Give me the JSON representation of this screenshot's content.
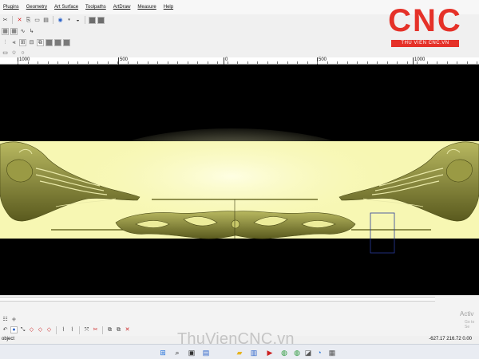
{
  "menu": [
    "Plugins",
    "Geometry",
    "Art Surface",
    "Toolpaths",
    "ArtDraw",
    "Measure",
    "Help"
  ],
  "logo": {
    "text": "CNC",
    "subtitle": "THU VIEN CNC.VN",
    "color": "#e53128"
  },
  "ruler": {
    "labels": [
      "1000",
      "500",
      "0",
      "500",
      "1000"
    ]
  },
  "canvas": {
    "background": "#000000",
    "relief_band_color": "#f7f7b3",
    "relief_color": "#8a8a3c"
  },
  "status": {
    "left_text": "object",
    "coordinates": "-627.17 216.72 0.00"
  },
  "activation": {
    "title": "Activ",
    "subtitle": "Go to Se"
  },
  "watermark": "ThuVienCNC.vn",
  "icons": {
    "toolbar1": [
      "cut-icon",
      "delete-icon",
      "copy-icon",
      "paste-icon",
      "print-icon",
      "globe-icon",
      "dropdown-icon",
      "preview-icon",
      "shield-icon",
      "shield-icon"
    ],
    "toolbar2": [
      "grid-icon",
      "grid-icon",
      "curve-icon",
      "arrow-icon"
    ],
    "toolbar3": [
      "align-icon",
      "distribute-icon",
      "grid-icon",
      "transform-icon",
      "copy-icon",
      "shield-icon",
      "shield-icon",
      "shield-icon"
    ],
    "toolbar4": [
      "rectangle-icon",
      "star-icon",
      "circle-icon"
    ],
    "lowbar1": [
      "layers-icon",
      "pin-icon"
    ],
    "lowbar2": [
      "undo-icon",
      "select-icon",
      "node-icon",
      "diamond-icon",
      "diamond-icon",
      "diamond-icon",
      "blade-icon",
      "blade-icon",
      "weld-icon",
      "cut-icon",
      "layer-icon",
      "layer-icon",
      "delete-icon"
    ],
    "taskbar": [
      "windows-icon",
      "search-icon",
      "taskview-icon",
      "explorer-icon",
      "folder-icon",
      "chart-icon",
      "terminal-icon",
      "chrome-icon",
      "chrome-icon",
      "app-icon",
      "edge-icon",
      "app-icon"
    ]
  }
}
